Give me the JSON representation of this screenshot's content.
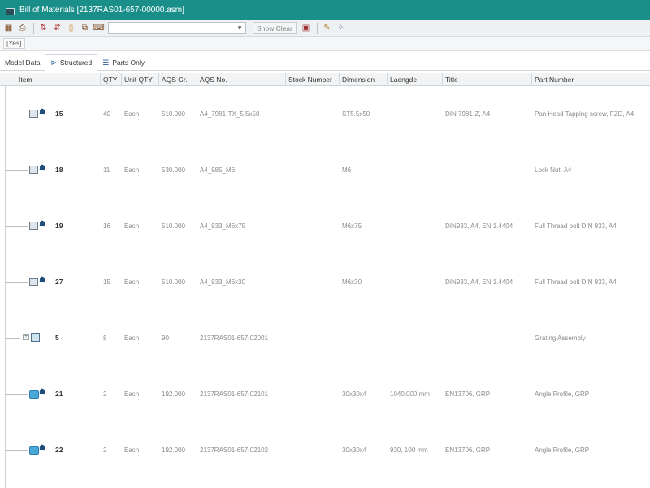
{
  "window": {
    "title": "Bill of Materials [2137RAS01-657-00000.asm]"
  },
  "toolbar": {
    "combo_value": "",
    "show_clear_label": "Show Clear"
  },
  "subbar": {
    "button_label": "[Yes]"
  },
  "tabs": [
    {
      "label": "Model Data",
      "active": false,
      "icon": ""
    },
    {
      "label": "Structured",
      "active": true,
      "icon": "structure-icon"
    },
    {
      "label": "Parts Only",
      "active": false,
      "icon": "parts-list-icon"
    }
  ],
  "columns": [
    "Item",
    "QTY",
    "Unit QTY",
    "AQS Gr.",
    "AQS No.",
    "Stock Number",
    "Dimension",
    "Laengde",
    "Title",
    "Part Number"
  ],
  "rows": [
    {
      "item": "15",
      "qty": "40",
      "unit": "Each",
      "aqs_gr": "510.000",
      "aqs_no": "A4_7981-TX_5,5x50",
      "stock": "",
      "dimension": "ST5.5x50",
      "length": "",
      "title": "DIN 7981-Z, A4",
      "part": "Pan Head Tapping screw, FZD, A4",
      "icon": "part-icon"
    },
    {
      "item": "18",
      "qty": "11",
      "unit": "Each",
      "aqs_gr": "530.000",
      "aqs_no": "A4_985_M6",
      "stock": "",
      "dimension": "M6",
      "length": "",
      "title": "",
      "part": "Lock Nut, A4",
      "icon": "part-icon"
    },
    {
      "item": "19",
      "qty": "16",
      "unit": "Each",
      "aqs_gr": "510.000",
      "aqs_no": "A4_933_M6x75",
      "stock": "",
      "dimension": "M6x75",
      "length": "",
      "title": "DIN933, A4, EN 1.4404",
      "part": "Full Thread bolt DIN 933, A4",
      "icon": "part-icon"
    },
    {
      "item": "27",
      "qty": "15",
      "unit": "Each",
      "aqs_gr": "510.000",
      "aqs_no": "A4_933_M6x30",
      "stock": "",
      "dimension": "M6x30",
      "length": "",
      "title": "DIN933, A4, EN 1.4404",
      "part": "Full Thread bolt DIN 933, A4",
      "icon": "part-icon"
    },
    {
      "item": "5",
      "qty": "8",
      "unit": "Each",
      "aqs_gr": "90",
      "aqs_no": "2137RAS01-657-02001",
      "stock": "",
      "dimension": "",
      "length": "",
      "title": "",
      "part": "Grating Assembly",
      "icon": "assembly-icon"
    },
    {
      "item": "21",
      "qty": "2",
      "unit": "Each",
      "aqs_gr": "192.000",
      "aqs_no": "2137RAS01-657-02101",
      "stock": "",
      "dimension": "30x30x4",
      "length": "1040,000 mm",
      "title": "EN13706, GRP",
      "part": "Angle Profile, GRP",
      "icon": "profile-icon"
    },
    {
      "item": "22",
      "qty": "2",
      "unit": "Each",
      "aqs_gr": "192.000",
      "aqs_no": "2137RAS01-657-02102",
      "stock": "",
      "dimension": "30x30x4",
      "length": "930, 100 mm",
      "title": "EN13706, GRP",
      "part": "Angle Profile, GRP",
      "icon": "profile-icon"
    }
  ]
}
